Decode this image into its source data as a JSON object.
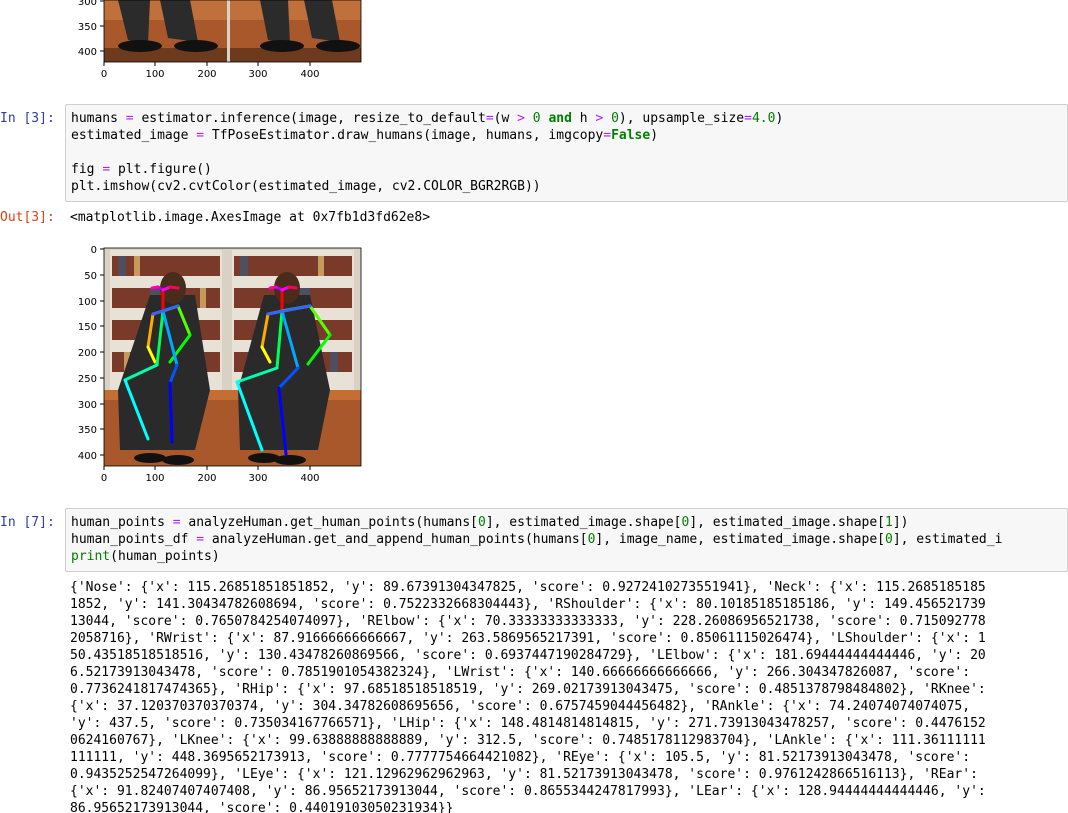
{
  "figure_top": {
    "ytick_labels": [
      "300",
      "350",
      "400"
    ],
    "xtick_labels": [
      "0",
      "100",
      "200",
      "300",
      "400"
    ]
  },
  "cell3": {
    "in_prompt": "In [3]:",
    "out_prompt": "Out[3]:",
    "line1": {
      "a": "humans ",
      "op1": "=",
      "b": " estimator.inference(image, resize_to_default",
      "op2": "=",
      "c": "(w ",
      "op3": ">",
      "d": " ",
      "n1": "0",
      "e": " ",
      "kw": "and",
      "f": " h ",
      "op4": ">",
      "g": " ",
      "n2": "0",
      "h": "), upsample_size",
      "op5": "=",
      "n3": "4.0",
      "i": ")"
    },
    "line2": {
      "a": "estimated_image ",
      "op1": "=",
      "b": " TfPoseEstimator.draw_humans(image, humans, imgcopy",
      "op2": "=",
      "kw": "False",
      "c": ")"
    },
    "line4": {
      "a": "fig ",
      "op1": "=",
      "b": " plt.figure()"
    },
    "line5": "plt.imshow(cv2.cvtColor(estimated_image, cv2.COLOR_BGR2RGB))",
    "output": "<matplotlib.image.AxesImage at 0x7fb1d3fd62e8>"
  },
  "figure_main": {
    "ytick_labels": [
      "0",
      "50",
      "100",
      "150",
      "200",
      "250",
      "300",
      "350",
      "400"
    ],
    "xtick_labels": [
      "0",
      "100",
      "200",
      "300",
      "400"
    ]
  },
  "cell7": {
    "in_prompt": "In [7]:",
    "line1": {
      "a": "human_points ",
      "op1": "=",
      "b": " analyzeHuman.get_human_points(humans[",
      "n1": "0",
      "c": "], estimated_image.shape[",
      "n2": "0",
      "d": "], estimated_image.shape[",
      "n3": "1",
      "e": "])"
    },
    "line2": {
      "a": "human_points_df ",
      "op1": "=",
      "b": " analyzeHuman.get_and_append_human_points(humans[",
      "n1": "0",
      "c": "], image_name, estimated_image.shape[",
      "n2": "0",
      "d": "], estimated_i"
    },
    "line3": {
      "fn": "print",
      "a": "(human_points)"
    },
    "output_lines": [
      "{'Nose': {'x': 115.26851851851852, 'y': 89.67391304347825, 'score': 0.9272410273551941}, 'Neck': {'x': 115.2685185185",
      "1852, 'y': 141.30434782608694, 'score': 0.7522332668304443}, 'RShoulder': {'x': 80.10185185185186, 'y': 149.456521739",
      "13044, 'score': 0.7650784254074097}, 'RElbow': {'x': 70.33333333333333, 'y': 228.26086956521738, 'score': 0.715092778",
      "2058716}, 'RWrist': {'x': 87.91666666666667, 'y': 263.5869565217391, 'score': 0.85061115026474}, 'LShoulder': {'x': 1",
      "50.43518518518516, 'y': 130.43478260869566, 'score': 0.6937447190284729}, 'LElbow': {'x': 181.69444444444446, 'y': 20",
      "6.52173913043478, 'score': 0.7851901054382324}, 'LWrist': {'x': 140.66666666666666, 'y': 266.304347826087, 'score':",
      "0.7736241817474365}, 'RHip': {'x': 97.68518518518519, 'y': 269.02173913043475, 'score': 0.4851378798484802}, 'RKnee':",
      "{'x': 37.120370370370374, 'y': 304.34782608695656, 'score': 0.6757459044456482}, 'RAnkle': {'x': 74.24074074074075,",
      "'y': 437.5, 'score': 0.735034167766571}, 'LHip': {'x': 148.4814814814815, 'y': 271.73913043478257, 'score': 0.4476152",
      "0624160767}, 'LKnee': {'x': 99.63888888888889, 'y': 312.5, 'score': 0.7485178112983704}, 'LAnkle': {'x': 111.36111111",
      "111111, 'y': 448.3695652173913, 'score': 0.7777754664421082}, 'REye': {'x': 105.5, 'y': 81.52173913043478, 'score':",
      "0.9435252547264099}, 'LEye': {'x': 121.12962962962963, 'y': 81.52173913043478, 'score': 0.9761242866516113}, 'REar':",
      "{'x': 91.82407407407408, 'y': 86.95652173913044, 'score': 0.8655344247817993}, 'LEar': {'x': 128.94444444444446, 'y':",
      "86.95652173913044, 'score': 0.44019103050231934}}"
    ]
  }
}
